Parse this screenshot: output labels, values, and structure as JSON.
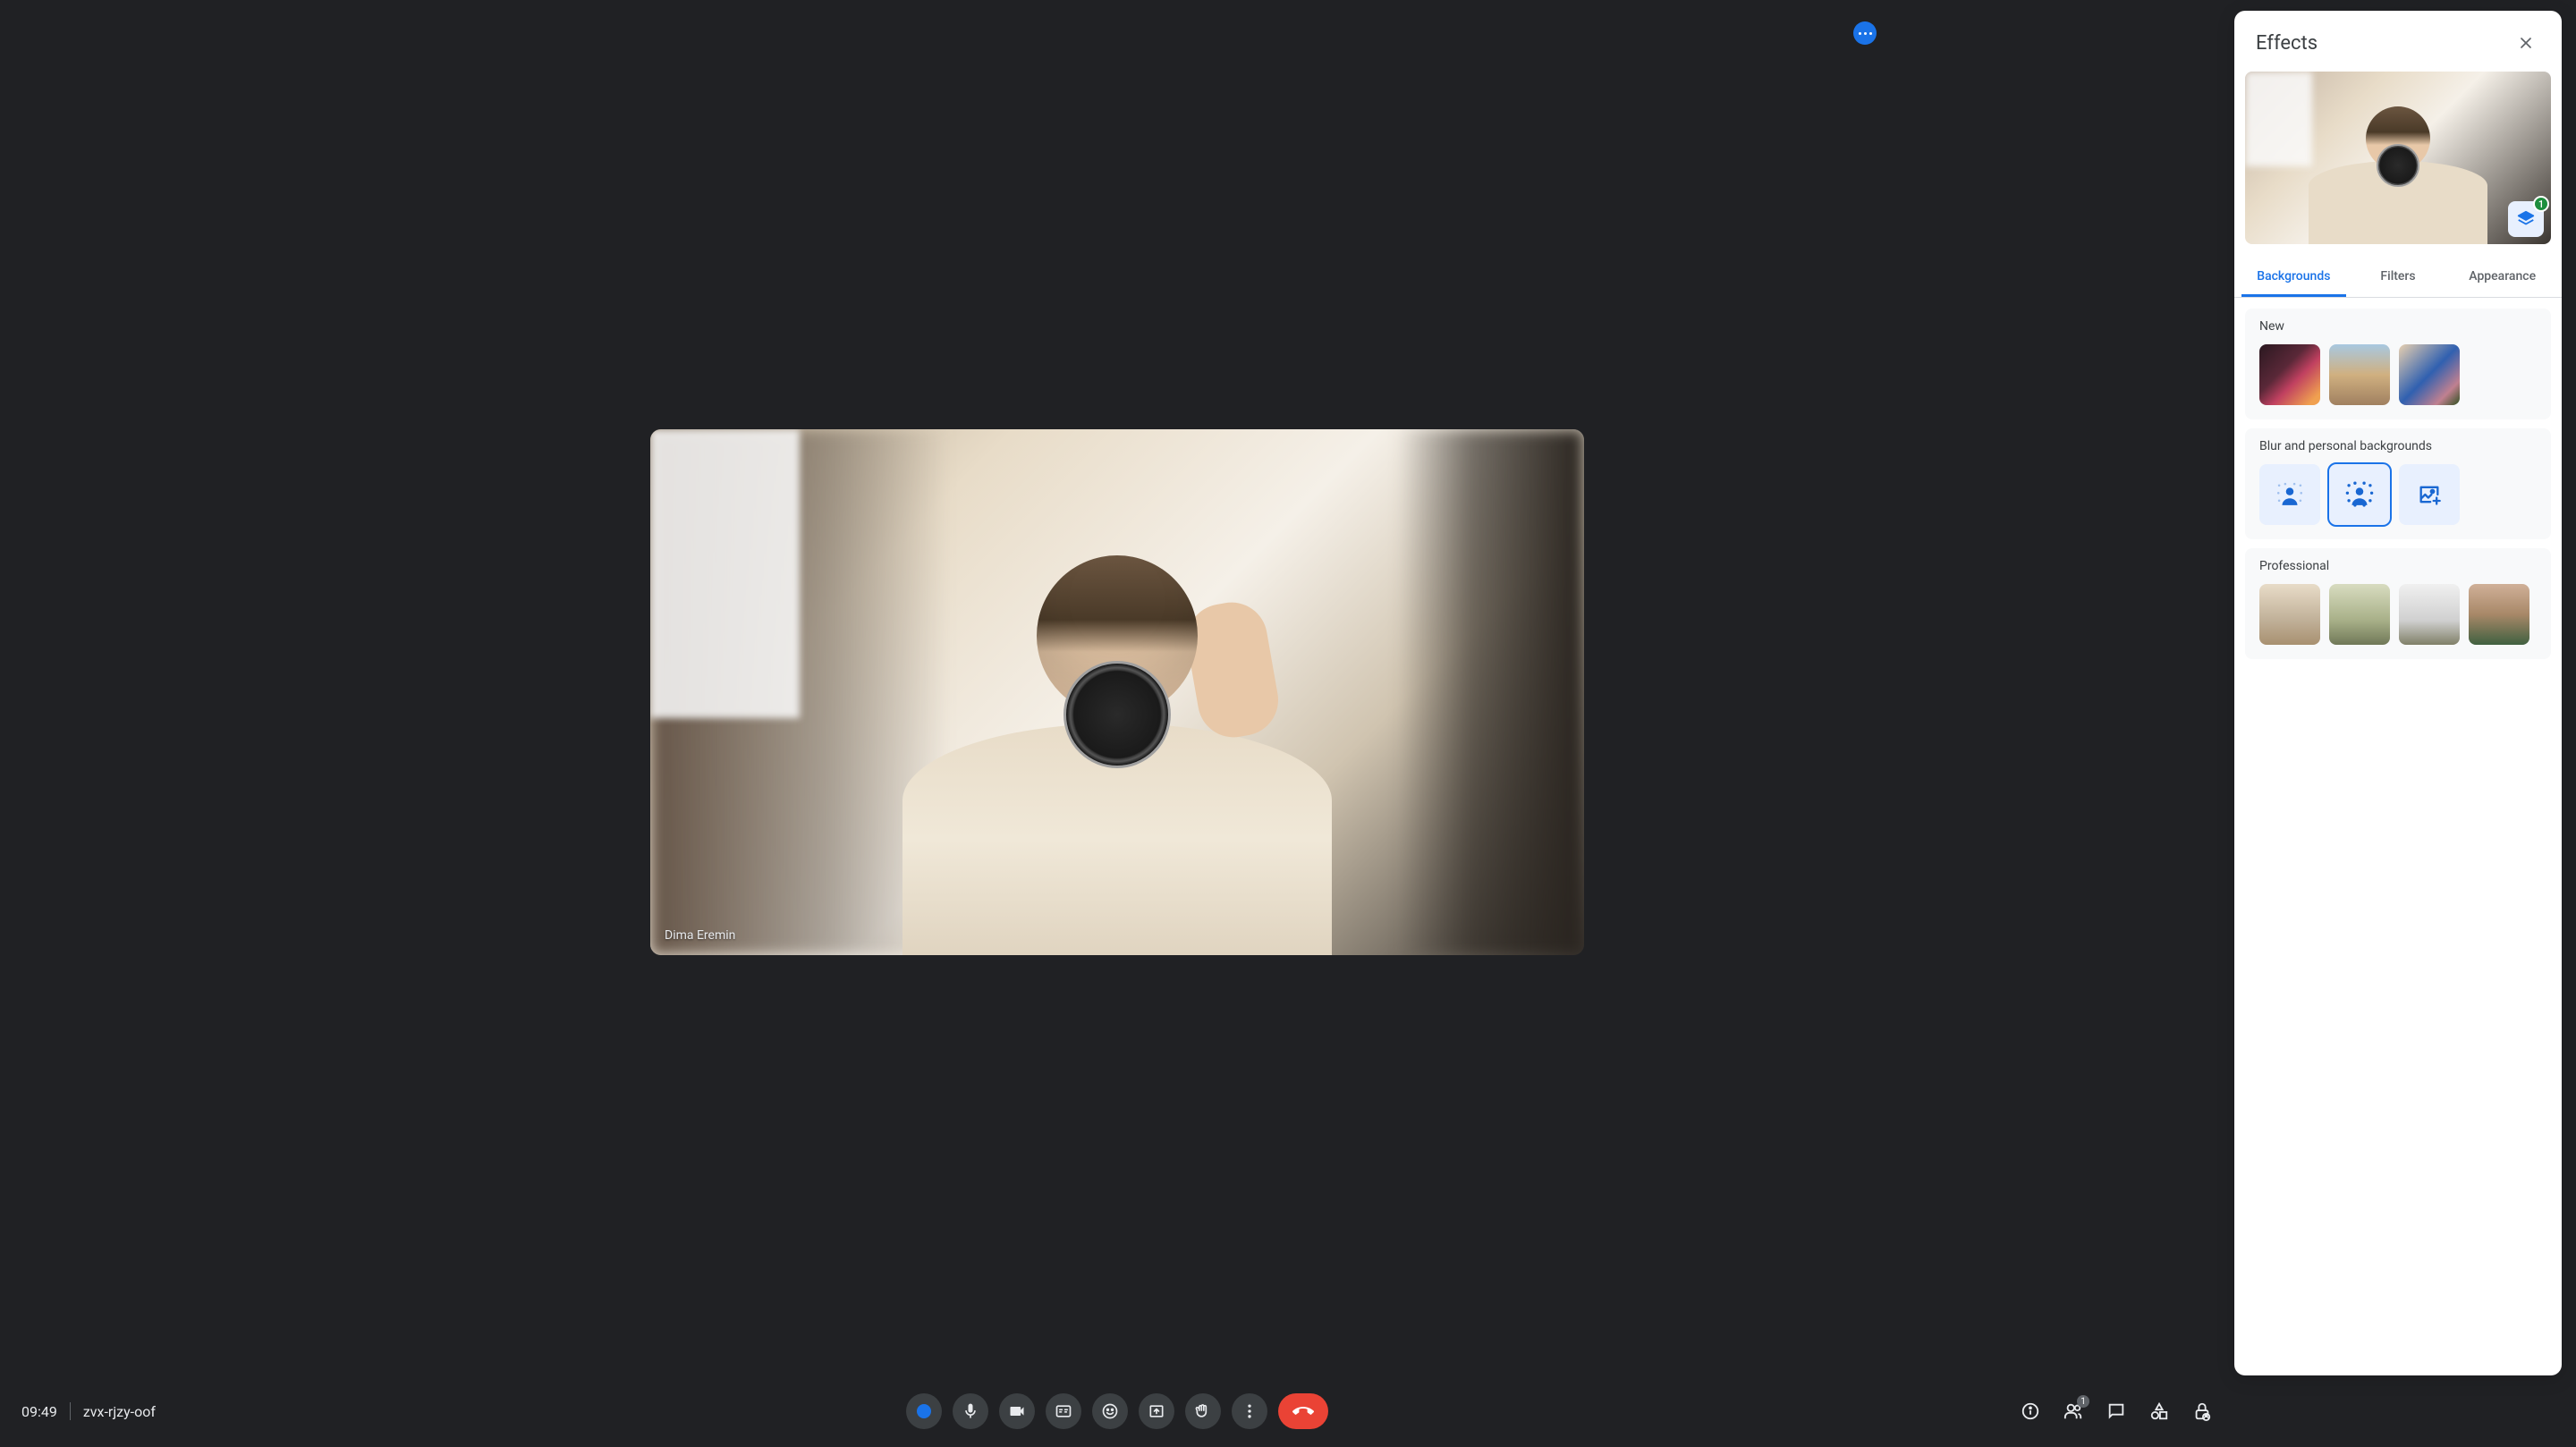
{
  "effects": {
    "title": "Effects",
    "layers_count": "1",
    "tabs": {
      "backgrounds": "Backgrounds",
      "filters": "Filters",
      "appearance": "Appearance"
    },
    "sections": {
      "new": "New",
      "blur": "Blur and personal backgrounds",
      "professional": "Professional"
    }
  },
  "participant": {
    "name": "Dima Eremin"
  },
  "meeting": {
    "time": "09:49",
    "code": "zvx-rjzy-oof",
    "participant_count": "1"
  }
}
